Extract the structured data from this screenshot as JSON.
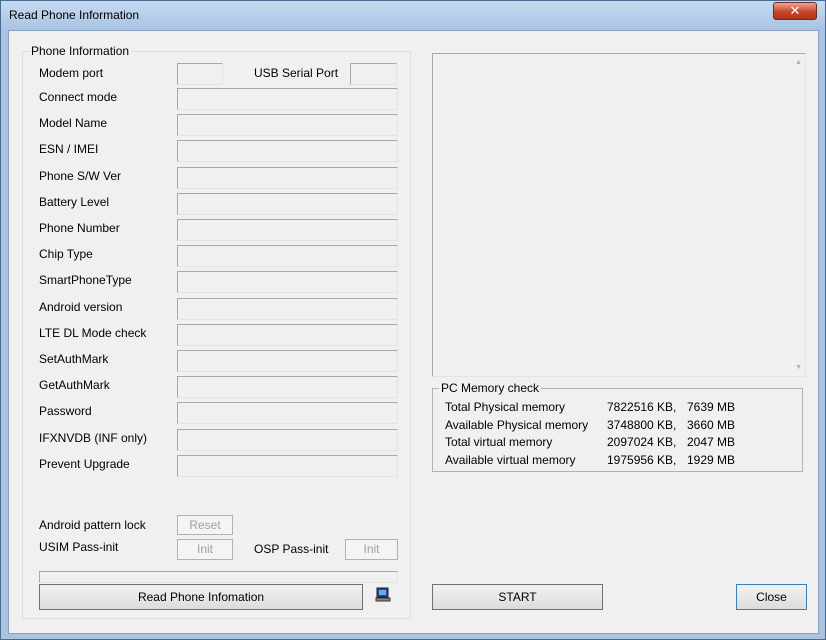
{
  "window": {
    "title": "Read Phone Information",
    "close_glyph": "✕"
  },
  "phone_info": {
    "legend": "Phone Information",
    "modem_port_label": "Modem port",
    "usb_serial_port_label": "USB Serial Port",
    "rows": [
      {
        "label": "Connect mode"
      },
      {
        "label": "Model Name"
      },
      {
        "label": "ESN / IMEI"
      },
      {
        "label": "Phone S/W Ver"
      },
      {
        "label": "Battery Level"
      },
      {
        "label": "Phone Number"
      },
      {
        "label": "Chip Type"
      },
      {
        "label": "SmartPhoneType"
      },
      {
        "label": "Android version"
      },
      {
        "label": "LTE DL Mode check"
      },
      {
        "label": "SetAuthMark"
      },
      {
        "label": "GetAuthMark"
      },
      {
        "label": "Password"
      },
      {
        "label": "IFXNVDB (INF only)"
      },
      {
        "label": "Prevent Upgrade"
      }
    ],
    "android_pattern_lock_label": "Android pattern lock",
    "reset_button": "Reset",
    "usim_pass_init_label": "USIM Pass-init",
    "init_button": "Init",
    "osp_pass_init_label": "OSP Pass-init",
    "osp_init_button": "Init",
    "progress": 0,
    "read_button": "Read Phone Infomation",
    "device_icon": "computer-phone-icon"
  },
  "pc_memory": {
    "legend": "PC Memory check",
    "rows": [
      {
        "label": "Total Physical memory",
        "kb": "7822516 KB,",
        "mb": "7639 MB"
      },
      {
        "label": "Available Physical memory",
        "kb": "3748800 KB,",
        "mb": "3660 MB"
      },
      {
        "label": "Total virtual memory",
        "kb": "2097024 KB,",
        "mb": "2047 MB"
      },
      {
        "label": "Available virtual memory",
        "kb": "1975956 KB,",
        "mb": "1929 MB"
      }
    ]
  },
  "buttons": {
    "start": "START",
    "close": "Close"
  }
}
